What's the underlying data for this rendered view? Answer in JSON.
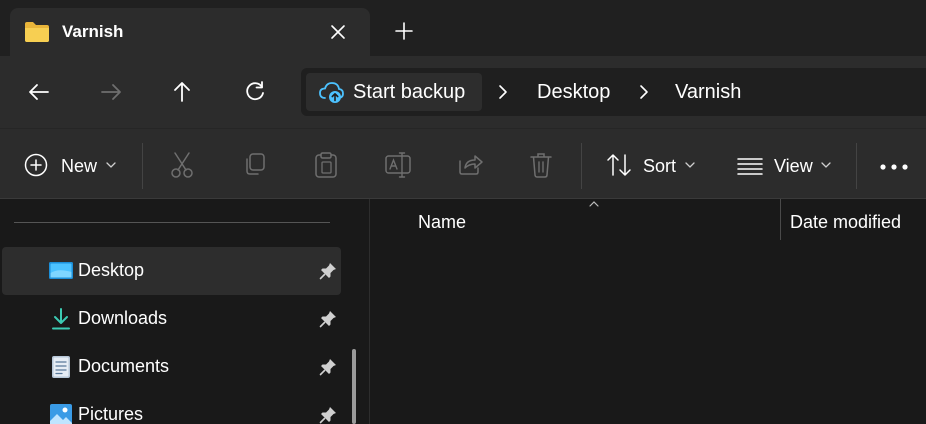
{
  "tab": {
    "title": "Varnish",
    "icon": "folder-icon",
    "close_icon": "close-icon",
    "new_tab_icon": "plus-icon"
  },
  "navigation": {
    "back_icon": "arrow-left-icon",
    "forward_icon": "arrow-right-icon",
    "up_icon": "arrow-up-icon",
    "refresh_icon": "refresh-icon",
    "forward_enabled": false
  },
  "address": {
    "backup_label": "Start backup",
    "backup_icon": "cloud-backup-icon",
    "breadcrumbs": [
      "Desktop",
      "Varnish"
    ]
  },
  "commands": {
    "new_label": "New",
    "sort_label": "Sort",
    "view_label": "View",
    "disabled_icons": [
      "cut-icon",
      "copy-icon",
      "paste-icon",
      "rename-icon",
      "share-icon",
      "delete-icon"
    ],
    "more_icon": "more-icon"
  },
  "sidebar": {
    "items": [
      {
        "label": "Desktop",
        "icon": "desktop-icon",
        "pinned": true,
        "selected": true
      },
      {
        "label": "Downloads",
        "icon": "download-icon",
        "pinned": true,
        "selected": false
      },
      {
        "label": "Documents",
        "icon": "document-icon",
        "pinned": true,
        "selected": false
      },
      {
        "label": "Pictures",
        "icon": "pictures-icon",
        "pinned": true,
        "selected": false
      }
    ]
  },
  "columns": {
    "name": "Name",
    "date_modified": "Date modified"
  },
  "colors": {
    "background": "#191919",
    "toolbar": "#2c2c2c",
    "tabstrip": "#202020",
    "accent": "#4cc2ff",
    "disabled": "#6f6f6f",
    "folder": "#f3c343"
  }
}
